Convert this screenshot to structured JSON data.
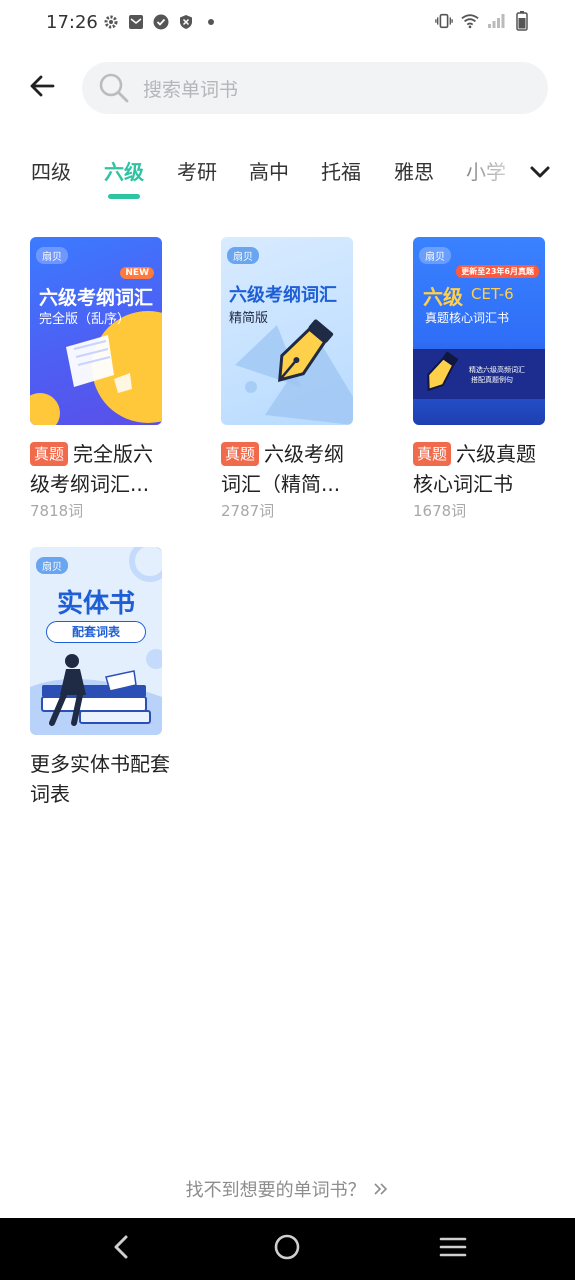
{
  "status_bar": {
    "time": "17:26",
    "left_icons": [
      "gear-icon",
      "mail-icon",
      "check-circle-icon",
      "shield-icon",
      "dot-icon"
    ],
    "right_icons": [
      "vibrate-icon",
      "wifi-icon",
      "signal-icon",
      "battery-icon"
    ]
  },
  "header": {
    "back_icon": "arrow-left-icon",
    "search_placeholder": "搜索单词书"
  },
  "tabs": [
    {
      "label": "四级",
      "active": false
    },
    {
      "label": "六级",
      "active": true
    },
    {
      "label": "考研",
      "active": false
    },
    {
      "label": "高中",
      "active": false
    },
    {
      "label": "托福",
      "active": false
    },
    {
      "label": "雅思",
      "active": false
    },
    {
      "label": "小学",
      "active": false
    }
  ],
  "accent_color": "#2ec4a1",
  "tag_color": "#f06a4b",
  "books": [
    {
      "tag": "真题",
      "title": "完全版六级考纲词汇...",
      "count": "7818词",
      "cover": {
        "brand": "扇贝",
        "badge": "NEW",
        "title": "六级考纲词汇",
        "subtitle": "完全版（乱序）"
      }
    },
    {
      "tag": "真题",
      "title": "六级考纲词汇（精简...",
      "count": "2787词",
      "cover": {
        "brand": "扇贝",
        "title": "六级考纲词汇",
        "subtitle": "精简版"
      }
    },
    {
      "tag": "真题",
      "title": "六级真题核心词汇书",
      "count": "1678词",
      "cover": {
        "brand": "扇贝",
        "badge": "更新至23年6月真题",
        "title_cn": "六级",
        "title_en": "CET-6",
        "subtitle": "真题核心词汇书",
        "blurb_1": "精选六级高频词汇",
        "blurb_2": "搭配真题例句"
      }
    },
    {
      "title": "更多实体书配套词表",
      "cover": {
        "brand": "扇贝",
        "title": "实体书",
        "subtitle": "配套词表"
      }
    }
  ],
  "footer": {
    "link_text": "找不到想要的单词书？",
    "link_icon": "double-chevron-right-icon"
  },
  "nav_bar": {
    "icons": [
      "back-triangle-icon",
      "home-circle-icon",
      "menu-lines-icon"
    ]
  }
}
